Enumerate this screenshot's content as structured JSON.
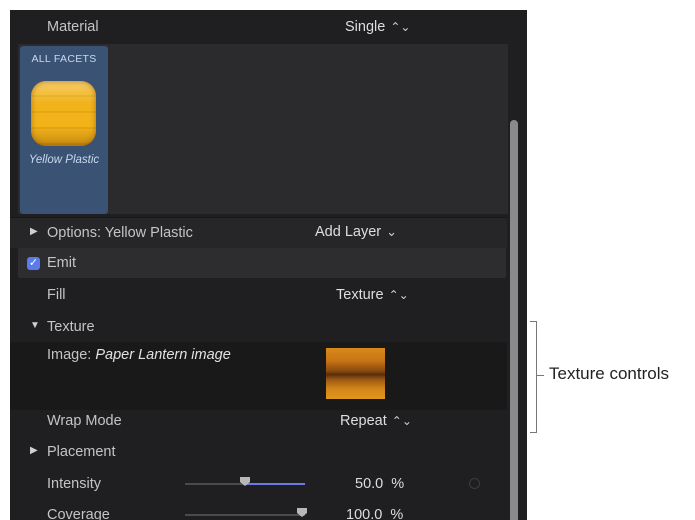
{
  "material": {
    "label": "Material",
    "value": "Single"
  },
  "facet": {
    "title": "ALL FACETS",
    "name": "Yellow Plastic"
  },
  "options": {
    "label": "Options: Yellow Plastic",
    "add_layer": "Add Layer"
  },
  "emit": {
    "label": "Emit",
    "checked": true
  },
  "fill": {
    "label": "Fill",
    "value": "Texture"
  },
  "texture": {
    "label": "Texture"
  },
  "image": {
    "label": "Image:",
    "name": "Paper Lantern image"
  },
  "wrap_mode": {
    "label": "Wrap Mode",
    "value": "Repeat"
  },
  "placement": {
    "label": "Placement"
  },
  "intensity": {
    "label": "Intensity",
    "value": "50.0",
    "unit": "%",
    "level": 0.5
  },
  "coverage": {
    "label": "Coverage",
    "value": "100.0",
    "unit": "%",
    "level": 1.0
  },
  "callout": {
    "text": "Texture controls"
  },
  "colors": {
    "accent": "#5a7be8",
    "panel": "#1f1f21",
    "facet": "#3a5274"
  },
  "icons": {
    "updown": "⌃⌄",
    "chevron_down": "⌄",
    "triangle_right": "▶",
    "triangle_down": "▼",
    "check": "✓"
  }
}
